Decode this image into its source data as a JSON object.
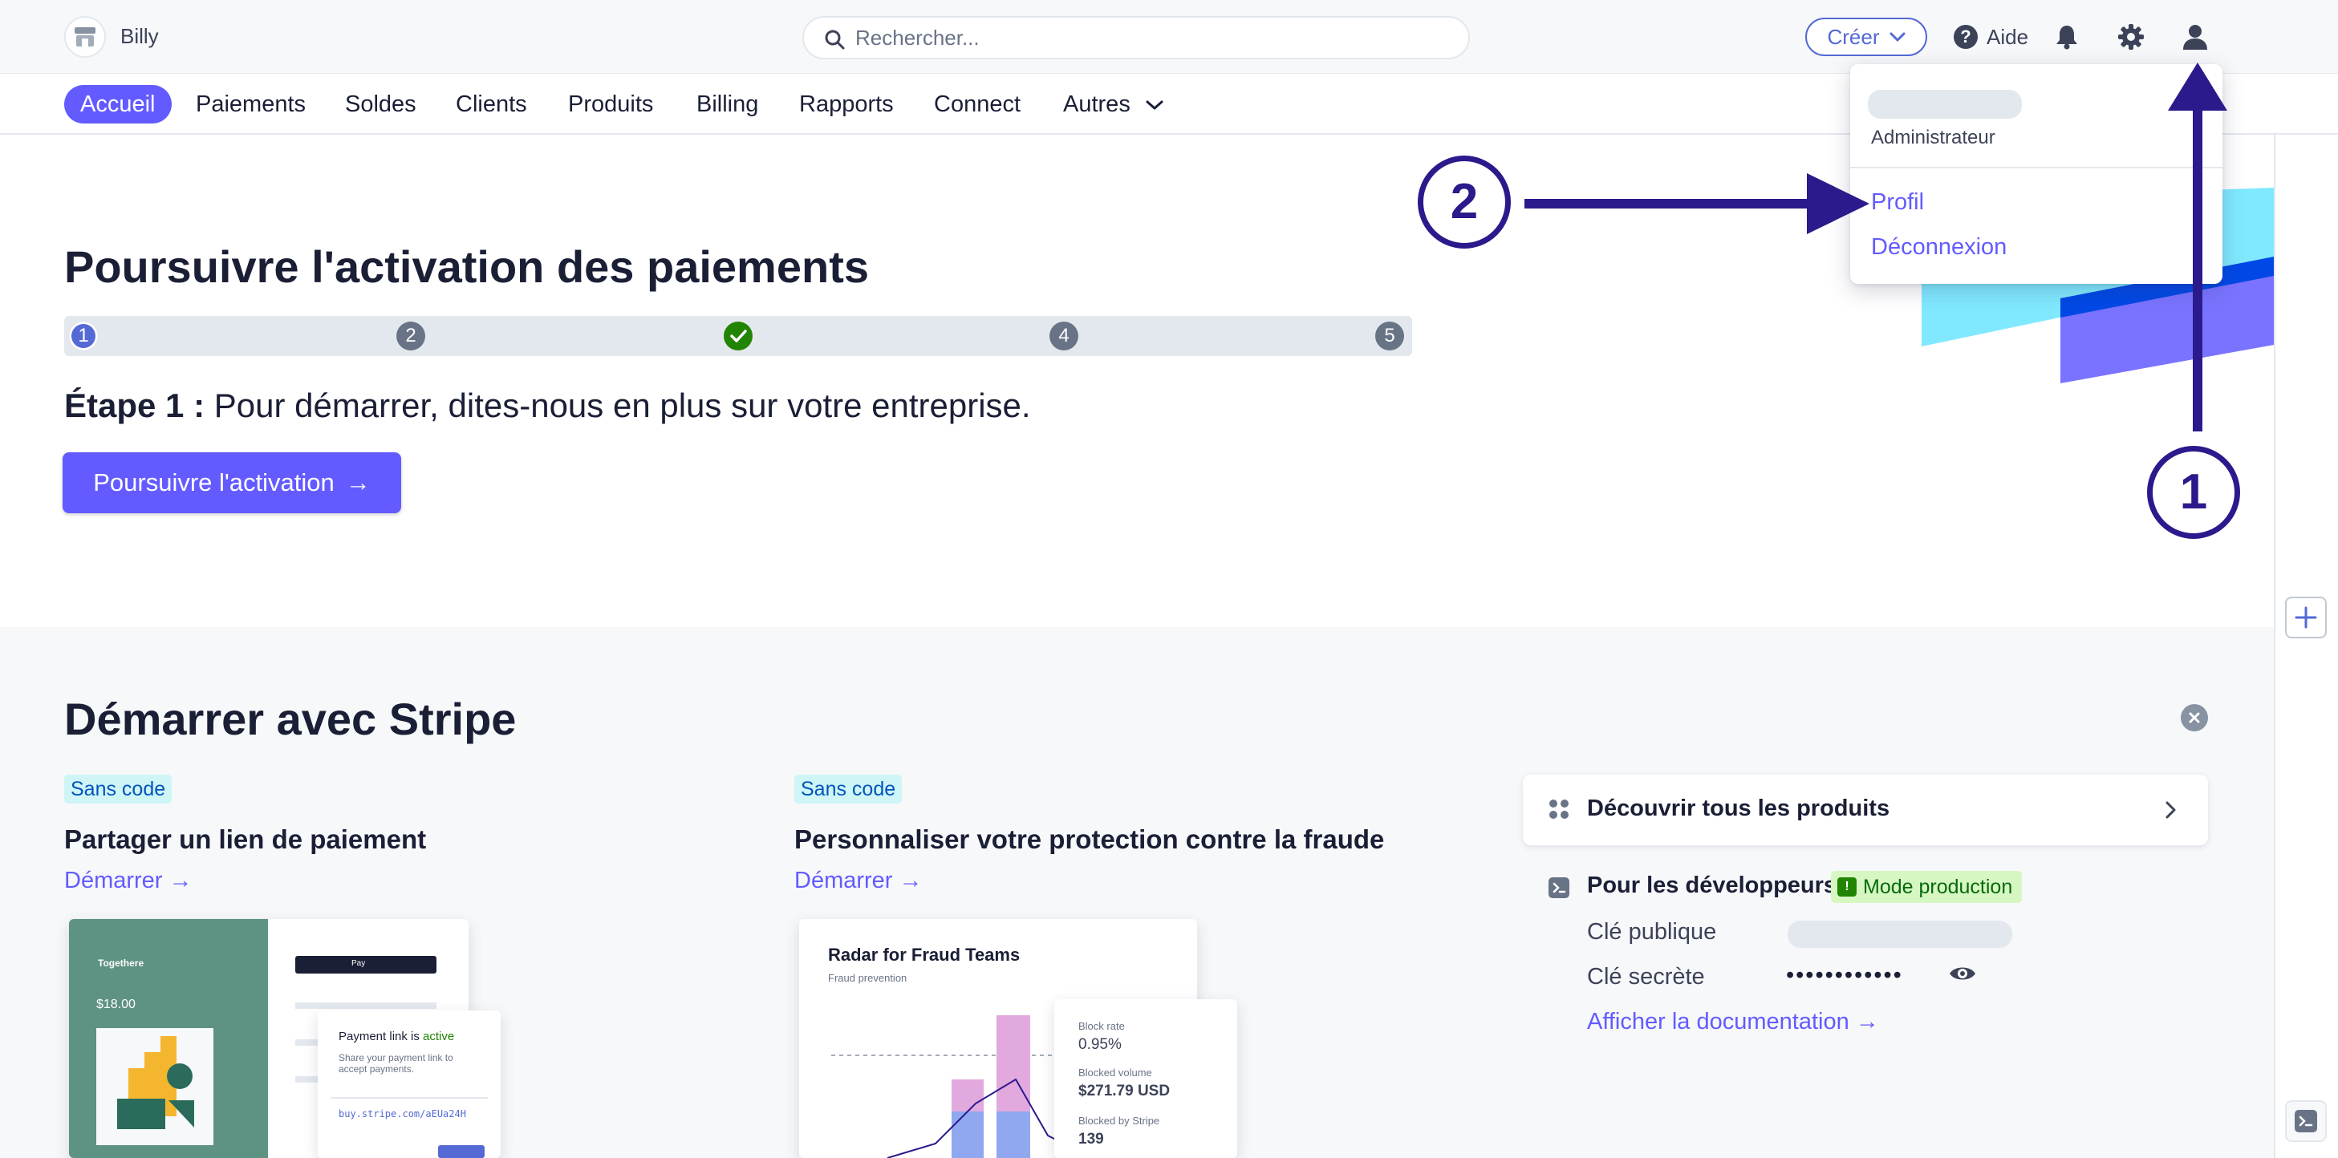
{
  "account": {
    "name": "Billy"
  },
  "search": {
    "placeholder": "Rechercher..."
  },
  "topbar": {
    "create_label": "Créer",
    "help_label": "Aide"
  },
  "nav": {
    "items": [
      "Accueil",
      "Paiements",
      "Soldes",
      "Clients",
      "Produits",
      "Billing",
      "Rapports",
      "Connect",
      "Autres"
    ]
  },
  "activation": {
    "title": "Poursuivre l'activation des paiements",
    "steps": [
      "1",
      "2",
      "",
      "4",
      "5"
    ],
    "step_prefix": "Étape 1 :",
    "step_text": " Pour démarrer, dites-nous en plus sur votre entreprise.",
    "button_label": "Poursuivre l'activation",
    "button_arrow": "→"
  },
  "getting_started": {
    "title": "Démarrer avec Stripe",
    "cards": [
      {
        "badge": "Sans code",
        "title": "Partager un lien de paiement",
        "link": "Démarrer →",
        "preview": {
          "brand": "Togethere",
          "price": "$18.00",
          "pay_button": "Pay",
          "popup_title_prefix": "Payment link is ",
          "popup_status": "active",
          "popup_desc": "Share your payment link to accept payments.",
          "popup_url": "buy.stripe.com/aEUa24H"
        }
      },
      {
        "badge": "Sans code",
        "title": "Personnaliser votre protection contre la fraude",
        "link": "Démarrer →",
        "preview": {
          "title": "Radar for Fraud Teams",
          "subtitle": "Fraud prevention",
          "stats": [
            {
              "label": "Block rate",
              "value": "0.95%"
            },
            {
              "label": "Blocked volume",
              "value": "$271.79 USD"
            },
            {
              "label": "Blocked by Stripe",
              "value": "139"
            }
          ]
        }
      }
    ],
    "discover_label": "Découvrir tous les produits",
    "developers": {
      "title": "Pour les développeurs",
      "mode_badge": "Mode production",
      "mode_badge_icon": "!",
      "public_key_label": "Clé publique",
      "secret_key_label": "Clé secrète",
      "secret_key_masked": "••••••••••••",
      "docs_link": "Afficher la documentation →"
    }
  },
  "dropdown": {
    "role": "Administrateur",
    "items": [
      "Profil",
      "Déconnexion"
    ]
  },
  "annotations": {
    "step_1": "1",
    "step_2": "2"
  },
  "colors": {
    "accent": "#635bff",
    "annotation": "#2a1a8c",
    "success": "#228403"
  }
}
